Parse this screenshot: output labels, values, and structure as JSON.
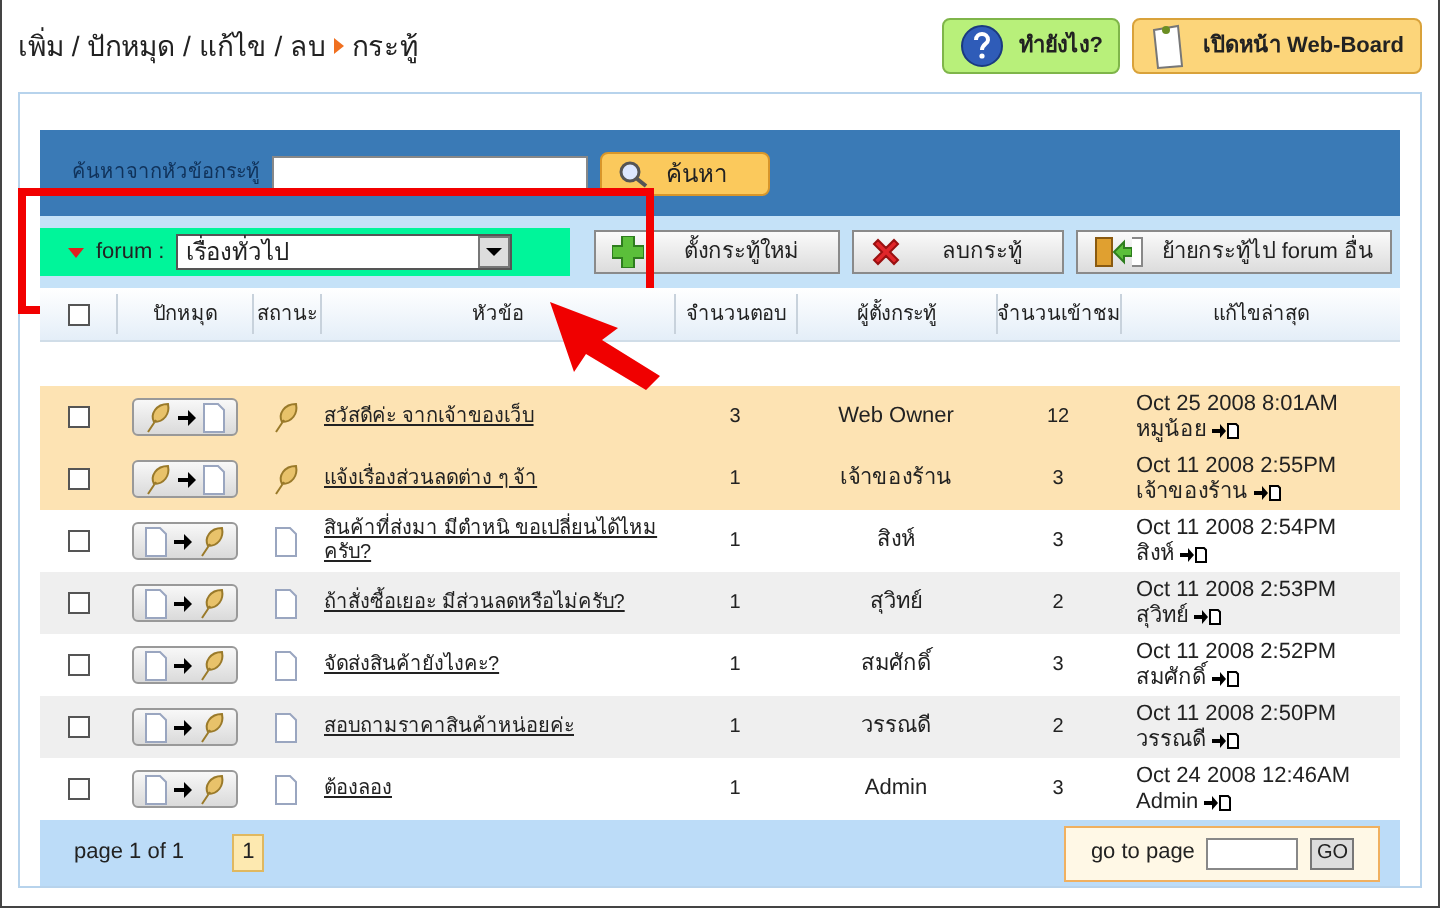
{
  "breadcrumb": {
    "path": "เพิ่ม / ปักหมุด / แก้ไข / ลบ",
    "current": "กระทู้"
  },
  "header_buttons": [
    {
      "kind": "help",
      "label": "ทำยังไง?"
    },
    {
      "kind": "board",
      "label": "เปิดหน้า Web-Board"
    }
  ],
  "search": {
    "label": "ค้นหาจากหัวข้อกระทู้",
    "button": "ค้นหา"
  },
  "forum": {
    "label": "forum :",
    "value": "เรื่องทั่วไป"
  },
  "toolbar": [
    {
      "kind": "add",
      "label": "ตั้งกระทู้ใหม่"
    },
    {
      "kind": "delete",
      "label": "ลบกระทู้"
    },
    {
      "kind": "move",
      "label": "ย้ายกระทู้ไป forum อื่น"
    }
  ],
  "table": {
    "header_checked": false,
    "columns": [
      "ปักหมุด",
      "สถานะ",
      "หัวข้อ",
      "จำนวนตอบ",
      "ผู้ตั้งกระทู้",
      "จำนวนเข้าชม",
      "แก้ไขล่าสุด"
    ],
    "rows": [
      {
        "checked": false,
        "pinned": true,
        "title": "สวัสดีค่ะ จากเจ้าของเว็บ",
        "replies": "3",
        "author": "Web Owner",
        "views": "12",
        "last_date": "Oct 25 2008 8:01AM",
        "last_user": "หมูน้อย"
      },
      {
        "checked": false,
        "pinned": true,
        "title": "แจ้งเรื่องส่วนลดต่าง ๆ จ้า",
        "replies": "1",
        "author": "เจ้าของร้าน",
        "views": "3",
        "last_date": "Oct 11 2008 2:55PM",
        "last_user": "เจ้าของร้าน"
      },
      {
        "checked": false,
        "pinned": false,
        "title": "สินค้าที่ส่งมา มีตำหนิ ขอเปลี่ยนได้ไหมครับ?",
        "replies": "1",
        "author": "สิงห์",
        "views": "3",
        "last_date": "Oct 11 2008 2:54PM",
        "last_user": "สิงห์"
      },
      {
        "checked": false,
        "pinned": false,
        "title": "ถ้าสั่งซื้อเยอะ มีส่วนลดหรือไม่ครับ?",
        "replies": "1",
        "author": "สุวิทย์",
        "views": "2",
        "last_date": "Oct 11 2008 2:53PM",
        "last_user": "สุวิทย์"
      },
      {
        "checked": false,
        "pinned": false,
        "title": "จัดส่งสินค้ายังไงคะ?",
        "replies": "1",
        "author": "สมศักดิ์",
        "views": "3",
        "last_date": "Oct 11 2008 2:52PM",
        "last_user": "สมศักดิ์"
      },
      {
        "checked": false,
        "pinned": false,
        "title": "สอบถามราคาสินค้าหน่อยค่ะ",
        "replies": "1",
        "author": "วรรณดี",
        "views": "2",
        "last_date": "Oct 11 2008 2:50PM",
        "last_user": "วรรณดี"
      },
      {
        "checked": false,
        "pinned": false,
        "title": "ต้องลอง",
        "replies": "1",
        "author": "Admin",
        "views": "3",
        "last_date": "Oct 24 2008 12:46AM",
        "last_user": "Admin"
      }
    ]
  },
  "pagination": {
    "summary": "page 1 of 1",
    "pages": [
      {
        "label": "1",
        "selected": true
      }
    ],
    "goto_label": "go to page",
    "goto_button": "GO"
  }
}
